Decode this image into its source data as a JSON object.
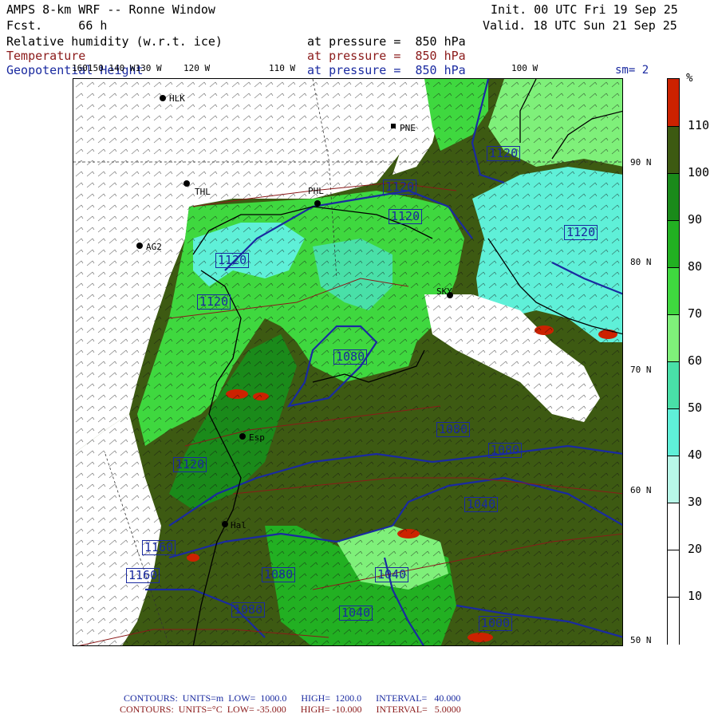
{
  "header": {
    "model": "AMPS 8-km WRF -- Ronne Window",
    "fcst": "Fcst.     66 h",
    "init": "Init. 00 UTC Fri 19 Sep 25",
    "valid": "Valid. 18 UTC Sun 21 Sep 25",
    "fields": [
      {
        "name": "Relative humidity (w.r.t. ice)",
        "level": "at pressure =  850 hPa",
        "color": "#000000"
      },
      {
        "name": "Temperature",
        "level": "at pressure =  850 hPa",
        "color": "#8b1a1a"
      },
      {
        "name": "Geopotential Height",
        "level": "at pressure =  850 hPa",
        "color": "#1a2aa0"
      }
    ],
    "smoothing": "sm= 2"
  },
  "lon_labels": [
    "160150 140 W130 W",
    "120 W",
    "110 W",
    "100 W"
  ],
  "lat_labels": [
    "90 N",
    "80 N",
    "70 N",
    "60 N",
    "50 N"
  ],
  "stations": [
    "HLK",
    "PNE",
    "THL",
    "PHL",
    "AG2",
    "SKY",
    "Esp",
    "Hal"
  ],
  "height_contour_labels": [
    "1120",
    "1120",
    "1120",
    "1120",
    "1120",
    "1120",
    "1120",
    "1080",
    "1080",
    "1080",
    "1080",
    "1040",
    "1040",
    "1040",
    "1000",
    "1160",
    "1160",
    "1080"
  ],
  "colorbar": {
    "unit": "%",
    "labels": [
      "110",
      "100",
      "90",
      "80",
      "70",
      "60",
      "50",
      "40",
      "30",
      "20",
      "10"
    ],
    "colors": [
      "#cc2200",
      "#3d5a12",
      "#1a8a1a",
      "#22b022",
      "#3fd83f",
      "#7ff07a",
      "#49e0a8",
      "#5ff0d8",
      "#b8f8e8",
      "#ffffff",
      "#ffffff",
      "#ffffff"
    ]
  },
  "footer": {
    "height_line": "CONTOURS:  UNITS=m  LOW=  1000.0      HIGH=  1200.0      INTERVAL=   40.000",
    "temp_line": "CONTOURS:  UNITS=°C  LOW= -35.000      HIGH= -10.000      INTERVAL=   5.0000"
  }
}
